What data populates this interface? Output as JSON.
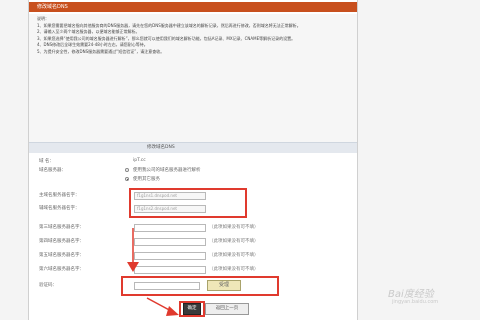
{
  "header": {
    "title": "修改域名DNS"
  },
  "notice": {
    "label": "说明：",
    "lines": [
      "1、如果您需要把域名指向其他服务商的DNS服务器，请先在您的DNS服务器中建立该域名的解析记录，然后再进行修改，否则域名将无法正常解析。",
      "2、请输入至少两个域名服务器，以便域名能够正常解析。",
      "3、如果您选择“使用我公司的域名服务器进行解析”，那么您就可以使用我们的域名解析功能，包括A记录、MX记录、CNAME等解析记录的设置。",
      "4、DNS修改后全球生效需要24-48小时左右，请您耐心等待。",
      "5、为提升安全性，修改DNS服务器需要通过“短信验证”，请注意查收。"
    ]
  },
  "form": {
    "title": "修改域名DNS",
    "domain_label": "域  名：",
    "domain_value": "ipT.cc",
    "dns_type_label": "域名服务器：",
    "radio_ours": "使用我公司的域名服务器进行解析",
    "radio_custom": "使用其它服务",
    "ns1_label": "主域名服务器名字：",
    "ns1_value": "f1g1ns1.dnspod.net",
    "ns2_label": "辅域名服务器名字：",
    "ns2_value": "f1g1ns2.dnspod.net",
    "ns3_label": "第三域名服务器名字：",
    "ns4_label": "第四域名服务器名字：",
    "ns5_label": "第五域名服务器名字：",
    "ns6_label": "第六域名服务器名字：",
    "optional_hint": "（此项如果没有可不填）",
    "captcha_label": "验证码：",
    "captcha_text": "受理",
    "submit_label": "确定",
    "cancel_label": "返回上一页"
  },
  "watermark": {
    "main": "Bai度经验",
    "sub": "jingyan.baidu.com"
  }
}
